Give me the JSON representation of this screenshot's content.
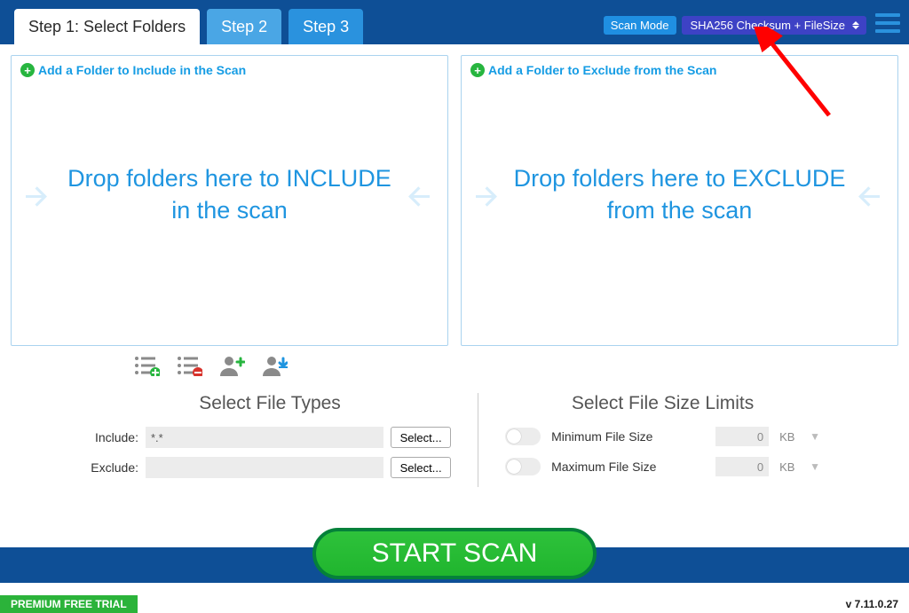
{
  "tabs": {
    "step1": "Step 1: Select Folders",
    "step2": "Step 2",
    "step3": "Step 3"
  },
  "scanmode": {
    "label": "Scan Mode",
    "value": "SHA256 Checksum + FileSize"
  },
  "include_pane": {
    "link": "Add a Folder to Include in the Scan",
    "drop": "Drop folders here to INCLUDE in the scan"
  },
  "exclude_pane": {
    "link": "Add a Folder to Exclude from the Scan",
    "drop": "Drop folders here to EXCLUDE from the scan"
  },
  "filetypes": {
    "heading": "Select File Types",
    "include_label": "Include:",
    "include_value": "*.*",
    "exclude_label": "Exclude:",
    "exclude_value": "",
    "select_btn": "Select..."
  },
  "sizelimits": {
    "heading": "Select File Size Limits",
    "min_label": "Minimum File Size",
    "max_label": "Maximum File Size",
    "min_value": "0",
    "max_value": "0",
    "unit": "KB"
  },
  "start": "START SCAN",
  "footer": {
    "trial": "PREMIUM FREE TRIAL",
    "version": "v 7.11.0.27"
  }
}
